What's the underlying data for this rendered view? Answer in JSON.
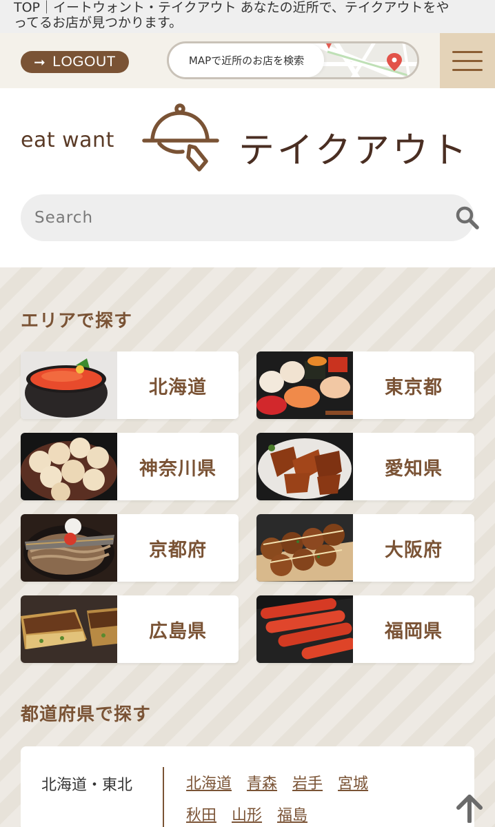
{
  "topbar": {
    "line1": "TOP｜イートウォント・テイクアウト あなたの近所で、テイクアウトをや",
    "line2": "ってるお店が見つかります。"
  },
  "header": {
    "logout_label": "LOGOUT",
    "map_label": "MAPで近所のお店を検索"
  },
  "logo": {
    "brand": "eat want",
    "product": "テイクアウト"
  },
  "search": {
    "placeholder": "Search"
  },
  "area_section": {
    "title": "エリアで探す",
    "cards": [
      {
        "label": "北海道"
      },
      {
        "label": "東京都"
      },
      {
        "label": "神奈川県"
      },
      {
        "label": "愛知県"
      },
      {
        "label": "京都府"
      },
      {
        "label": "大阪府"
      },
      {
        "label": "広島県"
      },
      {
        "label": "福岡県"
      }
    ]
  },
  "pref_section": {
    "title": "都道府県で探す",
    "region": "北海道・東北",
    "prefs": [
      "北海道",
      "青森",
      "岩手",
      "宮城",
      "秋田",
      "山形",
      "福島"
    ]
  },
  "colors": {
    "brand_brown": "#7a5335",
    "menu_bg": "#e4d3b8",
    "header_bg": "#f4f1ea"
  }
}
